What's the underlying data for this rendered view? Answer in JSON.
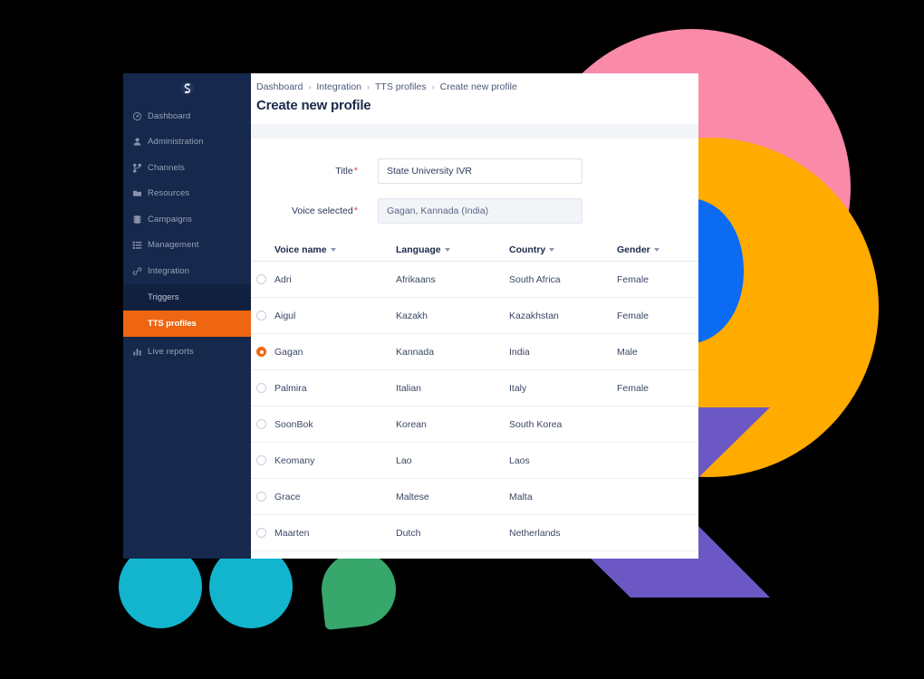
{
  "app": {
    "logo_icon": "hexagon-s-logo"
  },
  "sidebar": {
    "items": [
      {
        "label": "Dashboard",
        "icon": "gauge-icon"
      },
      {
        "label": "Administration",
        "icon": "user-icon"
      },
      {
        "label": "Channels",
        "icon": "branch-icon"
      },
      {
        "label": "Resources",
        "icon": "folder-icon"
      },
      {
        "label": "Campaigns",
        "icon": "layers-icon"
      },
      {
        "label": "Management",
        "icon": "list-icon"
      },
      {
        "label": "Integration",
        "icon": "link-icon"
      }
    ],
    "sub_items": [
      {
        "label": "Triggers",
        "active": false
      },
      {
        "label": "TTS profiles",
        "active": true
      }
    ],
    "tail_items": [
      {
        "label": "Live reports",
        "icon": "bar-chart-icon"
      }
    ]
  },
  "breadcrumb": {
    "items": [
      "Dashboard",
      "Integration",
      "TTS profiles",
      "Create new profile"
    ],
    "separator": "›"
  },
  "header": {
    "title": "Create new profile"
  },
  "form": {
    "title": {
      "label": "Title",
      "required_mark": "*",
      "value": "State University IVR"
    },
    "voice_selected": {
      "label": "Voice selected",
      "required_mark": "*",
      "value": "Gagan, Kannada (India)"
    }
  },
  "table": {
    "columns": [
      {
        "key": "name",
        "label": "Voice name",
        "sort_icon": "chevron-down-icon"
      },
      {
        "key": "lang",
        "label": "Language",
        "sort_icon": "chevron-down-icon"
      },
      {
        "key": "country",
        "label": "Country",
        "sort_icon": "chevron-down-icon"
      },
      {
        "key": "gender",
        "label": "Gender",
        "sort_icon": "chevron-down-icon"
      }
    ],
    "rows": [
      {
        "selected": false,
        "name": "Adri",
        "lang": "Afrikaans",
        "country": "South Africa",
        "gender": "Female"
      },
      {
        "selected": false,
        "name": "Aigul",
        "lang": "Kazakh",
        "country": "Kazakhstan",
        "gender": "Female"
      },
      {
        "selected": true,
        "name": "Gagan",
        "lang": "Kannada",
        "country": "India",
        "gender": "Male"
      },
      {
        "selected": false,
        "name": "Palmira",
        "lang": "Italian",
        "country": "Italy",
        "gender": "Female"
      },
      {
        "selected": false,
        "name": "SoonBok",
        "lang": "Korean",
        "country": "South Korea",
        "gender": ""
      },
      {
        "selected": false,
        "name": "Keomany",
        "lang": "Lao",
        "country": "Laos",
        "gender": ""
      },
      {
        "selected": false,
        "name": "Grace",
        "lang": "Maltese",
        "country": "Malta",
        "gender": ""
      },
      {
        "selected": false,
        "name": "Maarten",
        "lang": "Dutch",
        "country": "Netherlands",
        "gender": ""
      }
    ]
  },
  "decor": {
    "pink_circle": "#F98AA8",
    "orange_circle": "#FFAB00",
    "blue_crescent": "#0B6BF2",
    "purple_chevron": "#6B58C4",
    "cyan_quotes": "#13B5CE",
    "green_leaf": "#38A76B",
    "background": "#000000"
  },
  "colors": {
    "sidebar_bg": "#16284C",
    "sidebar_sub_bg": "#11203E",
    "accent_orange": "#EE6611",
    "required_red": "#E8453C",
    "text_dark": "#1B2A4A"
  }
}
